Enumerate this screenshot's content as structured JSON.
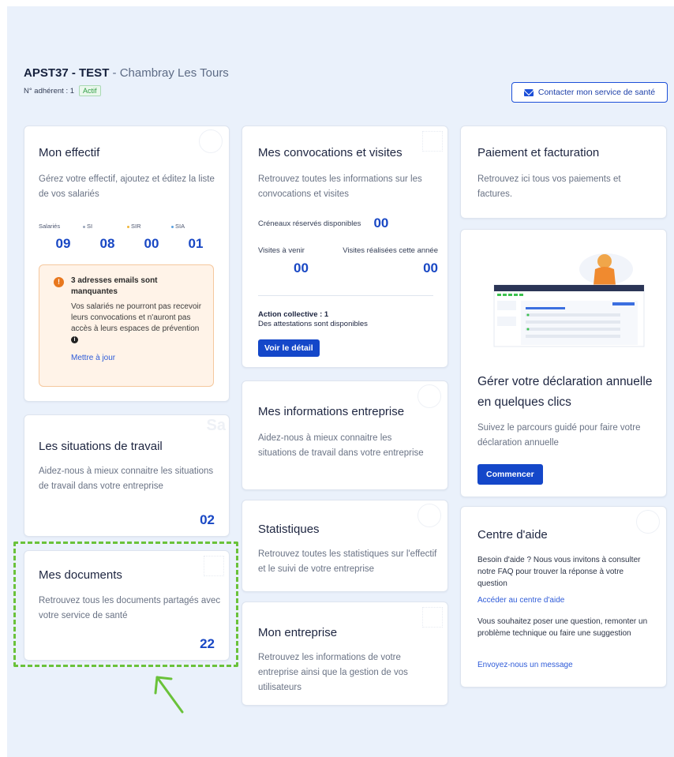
{
  "header": {
    "company": "APST37 - TEST",
    "location": " - Chambray Les Tours",
    "adherent_label": "N° adhérent : 1",
    "status": "Actif",
    "contact_button": "Contacter mon service de santé"
  },
  "effectif": {
    "title": "Mon effectif",
    "description": "Gérez votre effectif, ajoutez et éditez la liste de vos salariés",
    "stats": [
      {
        "label": "Salariés",
        "value": "09"
      },
      {
        "label": "SI",
        "value": "08"
      },
      {
        "label": "SIR",
        "value": "00"
      },
      {
        "label": "SIA",
        "value": "01"
      }
    ],
    "alert_title": "3 adresses emails sont manquantes",
    "alert_body": "Vos salariés ne pourront pas recevoir leurs convocations et n'auront pas accès à leurs espaces de prévention",
    "alert_link": "Mettre à jour"
  },
  "convocations": {
    "title": "Mes convocations et visites",
    "description": "Retrouvez toutes les informations sur les convocations et visites",
    "slots_label": "Créneaux réservés disponibles",
    "slots_value": "00",
    "upcoming_label": "Visites à venir",
    "upcoming_value": "00",
    "done_label": "Visites réalisées cette année",
    "done_value": "00",
    "action_title": "Action collective : 1",
    "action_text": "Des attestations sont disponibles",
    "detail_button": "Voir le détail"
  },
  "paiement": {
    "title": "Paiement et facturation",
    "description": "Retrouvez ici tous vos paiements et factures."
  },
  "declaration": {
    "title": "Gérer votre déclaration annuelle en quelques clics",
    "description": "Suivez le parcours guidé pour faire votre déclaration annuelle",
    "button": "Commencer"
  },
  "situations": {
    "title": "Les situations de travail",
    "description": "Aidez-nous à mieux connaitre les situations de travail dans votre entreprise",
    "count": "02",
    "deco": "Sa"
  },
  "infos": {
    "title": "Mes informations entreprise",
    "description": "Aidez-nous à mieux connaitre les situations de travail dans votre entreprise"
  },
  "statistiques": {
    "title": "Statistiques",
    "description": "Retrouvez toutes les statistiques sur l'effectif et le suivi de votre entreprise"
  },
  "documents": {
    "title": "Mes documents",
    "description": "Retrouvez tous les documents partagés avec votre service de santé",
    "count": "22"
  },
  "entreprise": {
    "title": "Mon entreprise",
    "description": "Retrouvez les informations de votre entreprise ainsi que la gestion de vos utilisateurs"
  },
  "aide": {
    "title": "Centre d'aide",
    "text1": "Besoin d'aide ? Nous vous invitons à consulter notre FAQ pour trouver la réponse à votre question",
    "link1": "Accéder au centre d'aide",
    "text2": "Vous souhaitez poser une question, remonter un problème technique ou faire une suggestion",
    "link2": "Envoyez-nous un message"
  },
  "colors": {
    "accent": "#1447c9",
    "highlight": "#6ac23a",
    "alert_bg": "#fff3e8"
  }
}
